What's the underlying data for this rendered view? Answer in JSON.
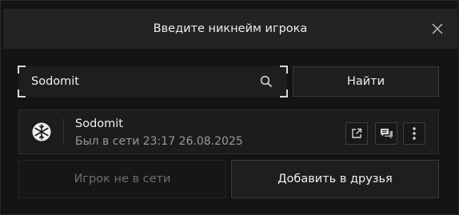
{
  "dialog": {
    "title": "Введите никнейм игрока",
    "close_icon": "close-icon"
  },
  "search": {
    "value": "Sodomit",
    "icon": "search-icon",
    "button_label": "Найти"
  },
  "player": {
    "name": "Sodomit",
    "status": "Был в сети 23:17 26.08.2025",
    "avatar_icon": "snowflake-icon",
    "actions": [
      "external-link-icon",
      "chat-icon",
      "more-vertical-icon"
    ]
  },
  "buttons": {
    "offline_label": "Игрок не в сети",
    "add_friend_label": "Добавить в друзья"
  },
  "colors": {
    "background": "#141414",
    "header": "#232323",
    "text": "#f0f0f0",
    "muted": "#9a9a9a",
    "disabled": "#6f6f6f"
  }
}
